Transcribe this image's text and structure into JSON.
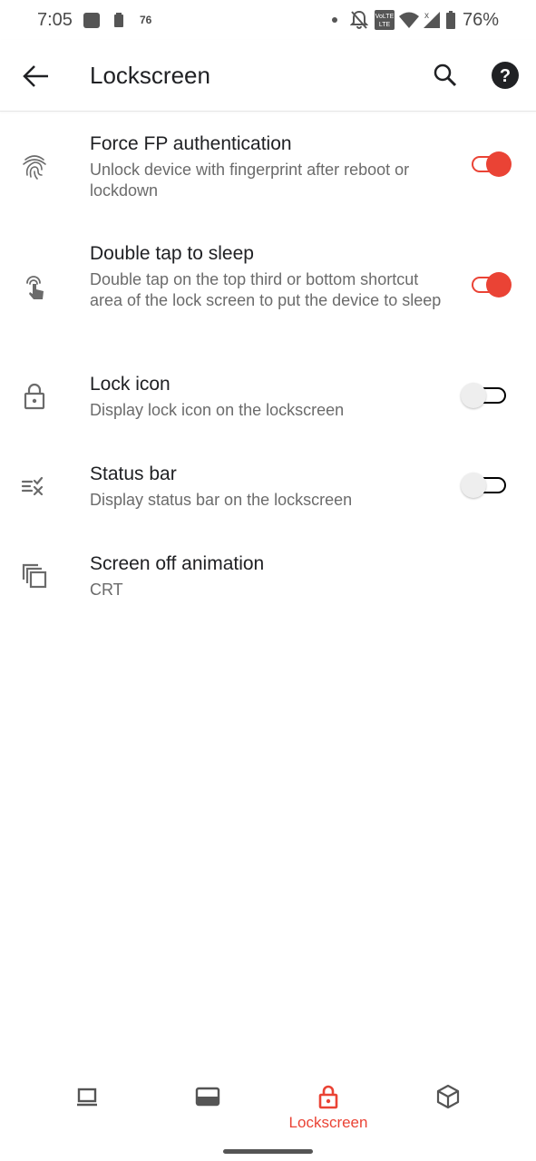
{
  "status_bar": {
    "time": "7:05",
    "small_indicator": "76",
    "battery_percent": "76%",
    "icons": [
      "photos-icon",
      "trash-icon",
      "dot-icon",
      "bell-off-icon",
      "volte-icon",
      "wifi-icon",
      "signal-icon",
      "battery-icon"
    ]
  },
  "app_bar": {
    "title": "Lockscreen",
    "back_icon": "arrow-back-icon",
    "search_icon": "search-icon",
    "help_icon": "help-icon"
  },
  "settings": [
    {
      "id": "force-fp",
      "icon": "fingerprint-icon",
      "title": "Force FP authentication",
      "summary": "Unlock device with fingerprint after reboot or lockdown",
      "switch": true
    },
    {
      "id": "double-tap",
      "icon": "touch-icon",
      "title": "Double tap to sleep",
      "summary": "Double tap on the top third or bottom shortcut area of the lock screen to put the device to sleep",
      "switch": true
    },
    {
      "id": "lock-icon",
      "icon": "lock-icon",
      "title": "Lock icon",
      "summary": "Display lock icon on the lockscreen",
      "switch": false
    },
    {
      "id": "status-bar",
      "icon": "status-bar-icon",
      "title": "Status bar",
      "summary": "Display status bar on the lockscreen",
      "switch": false
    },
    {
      "id": "screen-off",
      "icon": "animation-icon",
      "title": "Screen off animation",
      "summary": "CRT"
    }
  ],
  "bottom_nav": {
    "items": [
      {
        "icon": "laptop-icon",
        "label": ""
      },
      {
        "icon": "display-icon",
        "label": ""
      },
      {
        "icon": "lock-icon",
        "label": "Lockscreen",
        "active": true
      },
      {
        "icon": "cube-icon",
        "label": ""
      }
    ]
  },
  "colors": {
    "accent": "#ea4335",
    "text_primary": "#202124",
    "text_secondary": "#6b6b6b"
  }
}
